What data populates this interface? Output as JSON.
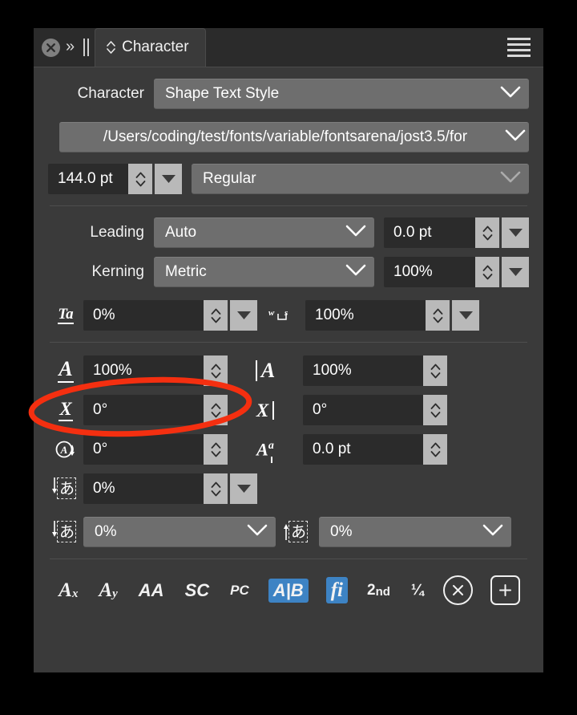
{
  "window": {
    "tab_label": "Character",
    "close_icon": "close-circle-icon",
    "expand_icon": "double-chevron-right-icon",
    "menu_icon": "hamburger-menu-icon"
  },
  "style_row": {
    "label": "Character",
    "value": "Shape Text Style"
  },
  "font_row": {
    "font_path": "/Users/coding/test/fonts/variable/fontsarena/jost3.5/for"
  },
  "size_row": {
    "size_value": "144.0 pt",
    "style_value": "Regular"
  },
  "leading_row": {
    "label": "Leading",
    "mode": "Auto",
    "value": "0.0 pt"
  },
  "kerning_row": {
    "label": "Kerning",
    "mode": "Metric",
    "value": "100%"
  },
  "tracking_row": {
    "icon": "tracking-icon",
    "value": "0%",
    "word_space_icon": "word-space-icon",
    "word_space_value": "100%"
  },
  "scale_row": {
    "h_icon": "horizontal-scale-icon",
    "h_value": "100%",
    "v_icon": "vertical-scale-icon",
    "v_value": "100%"
  },
  "skew_row": {
    "h_icon": "horizontal-skew-icon",
    "h_value": "0°",
    "v_icon": "vertical-skew-icon",
    "v_value": "0°"
  },
  "rotation_row": {
    "icon": "character-rotation-icon",
    "value": "0°",
    "baseline_icon": "baseline-shift-icon",
    "baseline_value": "0.0 pt"
  },
  "cjk_row": {
    "icon": "cjk-leading-icon",
    "value": "0%"
  },
  "cjk_pair_row": {
    "left_icon": "cjk-top-spacing-icon",
    "left_value": "0%",
    "right_icon": "cjk-bottom-spacing-icon",
    "right_value": "0%"
  },
  "footer": {
    "buttons": [
      {
        "name": "subscript-button",
        "label": "A",
        "sub": "x",
        "sup": "",
        "active": false,
        "kind": "serif"
      },
      {
        "name": "superscript-button",
        "label": "A",
        "sub": "",
        "sup": "y",
        "active": false,
        "kind": "serif"
      },
      {
        "name": "all-caps-button",
        "label": "AA",
        "sub": "",
        "sup": "",
        "active": false,
        "kind": "sans"
      },
      {
        "name": "small-caps-button",
        "label": "SC",
        "sub": "",
        "sup": "",
        "active": false,
        "kind": "sans"
      },
      {
        "name": "petite-caps-button",
        "label": "PC",
        "sub": "",
        "sup": "",
        "active": false,
        "kind": "small"
      },
      {
        "name": "kerning-toggle-button",
        "label": "A|B",
        "sub": "",
        "sup": "",
        "active": true,
        "kind": "sans"
      },
      {
        "name": "ligatures-button",
        "label": "fi",
        "sub": "",
        "sup": "",
        "active": true,
        "kind": "serif"
      },
      {
        "name": "ordinals-button",
        "label": "2",
        "sub": "",
        "sup": "nd",
        "active": false,
        "kind": "ord"
      },
      {
        "name": "fractions-button",
        "label": "¼",
        "sub": "",
        "sup": "",
        "active": false,
        "kind": "frac"
      }
    ],
    "clear_icon": "clear-circle-x-icon",
    "add_icon": "add-plus-square-icon"
  },
  "annotation": {
    "shape": "ellipse",
    "color": "#f42f10",
    "target": "horizontal-scale-field"
  },
  "colors": {
    "panel_bg": "#3a3a3a",
    "tabbar_bg": "#2b2b2b",
    "field_dark": "#2b2b2b",
    "dropdown_bg": "#6e6e6e",
    "spinner_bg": "#b9b9b9",
    "accent_blue": "#3d83c4",
    "text": "#ffffff",
    "annotation_red": "#f42f10"
  }
}
